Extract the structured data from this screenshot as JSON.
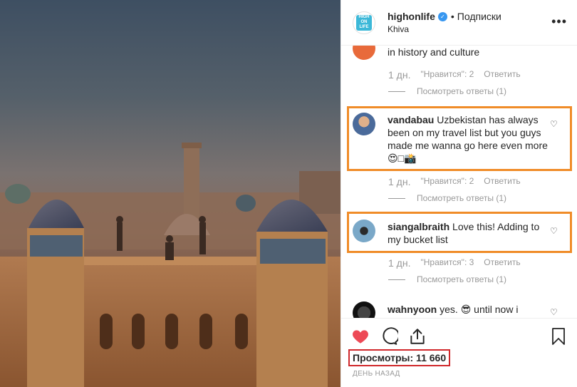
{
  "header": {
    "username": "highonlife",
    "dot": "•",
    "follow_label": "Подписки",
    "location": "Khiva",
    "more_label": "•••",
    "logo_text": [
      "HIGH",
      "ON",
      "LIFE"
    ]
  },
  "comments": [
    {
      "text": "in history and culture",
      "time": "1 дн.",
      "likes": "\"Нравится\": 2",
      "reply": "Ответить",
      "view_replies": "Посмотреть ответы (1)"
    },
    {
      "user": "vandabau",
      "text": " Uzbekistan has always been on my travel list but you guys made me wanna go here even more 😍□📸",
      "time": "1 дн.",
      "likes": "\"Нравится\": 2",
      "reply": "Ответить",
      "view_replies": "Посмотреть ответы (1)"
    },
    {
      "user": "siangalbraith",
      "text": " Love this! Adding to my bucket list",
      "time": "1 дн.",
      "likes": "\"Нравится\": 3",
      "reply": "Ответить",
      "view_replies": "Посмотреть ответы (1)"
    },
    {
      "user": "wahnyoon",
      "text": " yes. 😎 until now i"
    }
  ],
  "actions": {
    "views": "Просмотры: 11 660",
    "posted": "ДЕНЬ НАЗАД"
  },
  "colors": {
    "highlight_orange": "#f08c28",
    "highlight_red": "#d0282b",
    "like_red": "#ed4956",
    "verified_blue": "#3897f0"
  }
}
